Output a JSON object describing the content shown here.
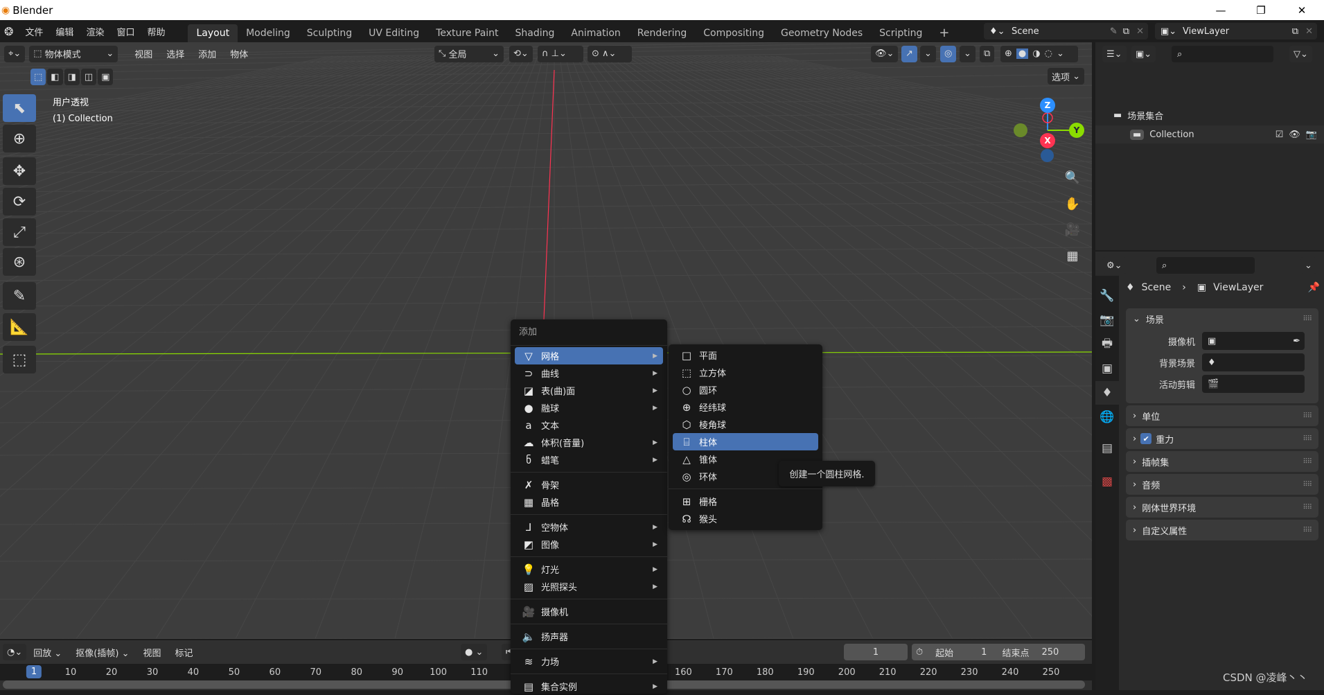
{
  "window": {
    "title": "Blender",
    "minimize": "—",
    "restore": "❐",
    "close": "✕"
  },
  "menubar": {
    "items": [
      "文件",
      "编辑",
      "渲染",
      "窗口",
      "帮助"
    ]
  },
  "workspaces": {
    "tabs": [
      "Layout",
      "Modeling",
      "Sculpting",
      "UV Editing",
      "Texture Paint",
      "Shading",
      "Animation",
      "Rendering",
      "Compositing",
      "Geometry Nodes",
      "Scripting"
    ],
    "active": "Layout",
    "add": "+"
  },
  "scene": {
    "name": "Scene",
    "view_layer": "ViewLayer"
  },
  "viewport_header": {
    "mode": "物体模式",
    "menus": [
      "视图",
      "选择",
      "添加",
      "物体"
    ],
    "orientation": "全局",
    "options": "选项"
  },
  "viewport": {
    "perspective": "用户透视",
    "collection": "(1) Collection",
    "gizmo": {
      "z": "Z",
      "y": "Y",
      "x": "X"
    }
  },
  "outliner": {
    "scene_collection": "场景集合",
    "collection": "Collection"
  },
  "properties": {
    "breadcrumb": {
      "scene": "Scene",
      "view_layer": "ViewLayer"
    },
    "scene_panel": {
      "title": "场景",
      "fields": [
        "摄像机",
        "背景场景",
        "活动剪辑"
      ]
    },
    "panels": [
      "单位",
      "重力",
      "插帧集",
      "音频",
      "刚体世界环境",
      "自定义属性"
    ],
    "gravity_enabled": true
  },
  "timeline": {
    "menus": [
      "回放",
      "抠像(插帧)",
      "视图",
      "标记"
    ],
    "current_frame": "1",
    "start_label": "起始",
    "start": "1",
    "end_label": "结束点",
    "end": "250",
    "frame_ticks": [
      "1",
      "10",
      "20",
      "30",
      "40",
      "50",
      "60",
      "70",
      "80",
      "90",
      "100",
      "110",
      "160",
      "170",
      "180",
      "190",
      "200",
      "210",
      "220",
      "230",
      "240",
      "250"
    ]
  },
  "add_menu": {
    "title": "添加",
    "groups": [
      [
        {
          "label": "网格",
          "icon": "▽",
          "sub": true,
          "hl": true
        },
        {
          "label": "曲线",
          "icon": "⊃",
          "sub": true
        },
        {
          "label": "表(曲)面",
          "icon": "◪",
          "sub": true
        },
        {
          "label": "融球",
          "icon": "●",
          "sub": true
        },
        {
          "label": "文本",
          "icon": "a",
          "sub": false
        },
        {
          "label": "体积(音量)",
          "icon": "☁",
          "sub": true
        },
        {
          "label": "蜡笔",
          "icon": "ნ",
          "sub": true
        }
      ],
      [
        {
          "label": "骨架",
          "icon": "✗",
          "sub": false
        },
        {
          "label": "晶格",
          "icon": "▦",
          "sub": false
        }
      ],
      [
        {
          "label": "空物体",
          "icon": "⅃",
          "sub": true
        },
        {
          "label": "图像",
          "icon": "◩",
          "sub": true
        }
      ],
      [
        {
          "label": "灯光",
          "icon": "💡",
          "sub": true
        },
        {
          "label": "光照探头",
          "icon": "▨",
          "sub": true
        }
      ],
      [
        {
          "label": "摄像机",
          "icon": "🎥",
          "sub": false
        }
      ],
      [
        {
          "label": "扬声器",
          "icon": "🔈",
          "sub": false
        }
      ],
      [
        {
          "label": "力场",
          "icon": "≋",
          "sub": true
        }
      ],
      [
        {
          "label": "集合实例",
          "icon": "▤",
          "sub": true
        }
      ]
    ]
  },
  "mesh_submenu": {
    "groups": [
      [
        {
          "label": "平面",
          "icon": "□"
        },
        {
          "label": "立方体",
          "icon": "⬚"
        },
        {
          "label": "圆环",
          "icon": "○"
        },
        {
          "label": "经纬球",
          "icon": "⊕"
        },
        {
          "label": "棱角球",
          "icon": "⬡"
        },
        {
          "label": "柱体",
          "icon": "⌸",
          "hl": true
        },
        {
          "label": "锥体",
          "icon": "△"
        },
        {
          "label": "环体",
          "icon": "◎"
        }
      ],
      [
        {
          "label": "栅格",
          "icon": "⊞"
        },
        {
          "label": "猴头",
          "icon": "☊"
        }
      ]
    ]
  },
  "tooltip": "创建一个圆柱网格.",
  "watermark": "CSDN @凌峰丶丶",
  "colors": {
    "accent": "#4772b3",
    "x_axis": "#ff3352",
    "y_axis": "#8bdc00",
    "z_axis": "#2c8fff",
    "viewport_bg": "#3d3d3d"
  }
}
